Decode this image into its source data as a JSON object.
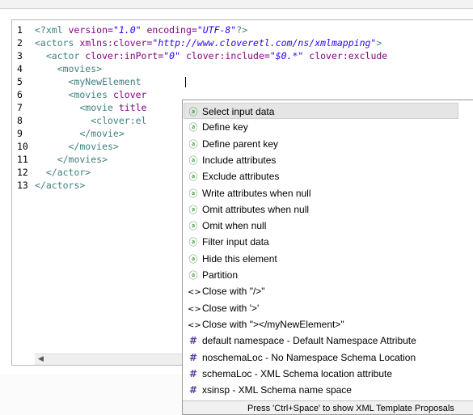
{
  "editor": {
    "lines": [
      {
        "num": "1",
        "parts": [
          {
            "t": "tag",
            "v": "<?xml "
          },
          {
            "t": "attr",
            "v": "version="
          },
          {
            "t": "val",
            "v": "\"1.0\""
          },
          {
            "t": "attr",
            "v": " encoding="
          },
          {
            "t": "val",
            "v": "\"UTF-8\""
          },
          {
            "t": "tag",
            "v": "?>"
          }
        ]
      },
      {
        "num": "2",
        "parts": [
          {
            "t": "tag",
            "v": "<actors "
          },
          {
            "t": "attr",
            "v": "xmlns:clover="
          },
          {
            "t": "val",
            "v": "\"http://www.cloveretl.com/ns/xmlmapping\""
          },
          {
            "t": "tag",
            "v": ">"
          }
        ]
      },
      {
        "num": "3",
        "parts": [
          {
            "t": "tag",
            "v": "  <actor "
          },
          {
            "t": "attr",
            "v": "clover:inPort="
          },
          {
            "t": "val",
            "v": "\"0\""
          },
          {
            "t": "attr",
            "v": " clover:include="
          },
          {
            "t": "val",
            "v": "\"$0.*\""
          },
          {
            "t": "attr",
            "v": " clover:exclude"
          }
        ]
      },
      {
        "num": "4",
        "parts": [
          {
            "t": "tag",
            "v": "    <movies>"
          }
        ]
      },
      {
        "num": "5",
        "parts": [
          {
            "t": "tag",
            "v": "      <myNewElement "
          }
        ]
      },
      {
        "num": "6",
        "parts": [
          {
            "t": "tag",
            "v": "      <movies "
          },
          {
            "t": "attr",
            "v": "clover"
          }
        ]
      },
      {
        "num": "7",
        "parts": [
          {
            "t": "tag",
            "v": "        <movie "
          },
          {
            "t": "attr",
            "v": "title"
          }
        ]
      },
      {
        "num": "8",
        "parts": [
          {
            "t": "tag",
            "v": "          <clover:el"
          }
        ]
      },
      {
        "num": "9",
        "parts": [
          {
            "t": "tag",
            "v": "        </movie>"
          }
        ]
      },
      {
        "num": "10",
        "parts": [
          {
            "t": "tag",
            "v": "      </movies>"
          }
        ]
      },
      {
        "num": "11",
        "parts": [
          {
            "t": "tag",
            "v": "    </movies>"
          }
        ]
      },
      {
        "num": "12",
        "parts": [
          {
            "t": "tag",
            "v": "  </actor>"
          }
        ]
      },
      {
        "num": "13",
        "parts": [
          {
            "t": "tag",
            "v": "</actors>"
          }
        ]
      }
    ]
  },
  "popup": {
    "items": [
      {
        "icon": "attribute-icon",
        "glyph": "ⓐ",
        "label": "Select input data",
        "selected": true
      },
      {
        "icon": "attribute-icon",
        "glyph": "ⓐ",
        "label": "Define key"
      },
      {
        "icon": "attribute-icon",
        "glyph": "ⓐ",
        "label": "Define parent key"
      },
      {
        "icon": "attribute-icon",
        "glyph": "ⓐ",
        "label": "Include attributes"
      },
      {
        "icon": "attribute-icon",
        "glyph": "ⓐ",
        "label": "Exclude attributes"
      },
      {
        "icon": "attribute-icon",
        "glyph": "ⓐ",
        "label": "Write attributes when null"
      },
      {
        "icon": "attribute-icon",
        "glyph": "ⓐ",
        "label": "Omit attributes when null"
      },
      {
        "icon": "attribute-icon",
        "glyph": "ⓐ",
        "label": "Omit when null"
      },
      {
        "icon": "attribute-icon",
        "glyph": "ⓐ",
        "label": "Filter input data"
      },
      {
        "icon": "attribute-icon",
        "glyph": "ⓐ",
        "label": "Hide this element"
      },
      {
        "icon": "attribute-icon",
        "glyph": "ⓐ",
        "label": "Partition"
      },
      {
        "icon": "tag-icon",
        "glyph": "<>",
        "label": "Close with  \"/>\""
      },
      {
        "icon": "tag-icon",
        "glyph": "<>",
        "label": "Close with  '>'"
      },
      {
        "icon": "tag-icon",
        "glyph": "<>",
        "label": "Close with  \"></myNewElement>\""
      },
      {
        "icon": "namespace-icon",
        "glyph": "#",
        "label": "default namespace - Default Namespace Attribute"
      },
      {
        "icon": "namespace-icon",
        "glyph": "#",
        "label": "noschemaLoc - No Namespace Schema Location"
      },
      {
        "icon": "namespace-icon",
        "glyph": "#",
        "label": "schemaLoc - XML Schema location attribute"
      },
      {
        "icon": "namespace-icon",
        "glyph": "#",
        "label": "xsinsp - XML Schema name space"
      }
    ],
    "footer": "Press 'Ctrl+Space' to show XML Template Proposals"
  },
  "scrollbar": {
    "left_arrow_glyph": "◀"
  },
  "colors": {
    "tag": "#3f7f7f",
    "attr": "#7f007f",
    "value": "#2a00ff",
    "selection": "#e5e5e5"
  }
}
